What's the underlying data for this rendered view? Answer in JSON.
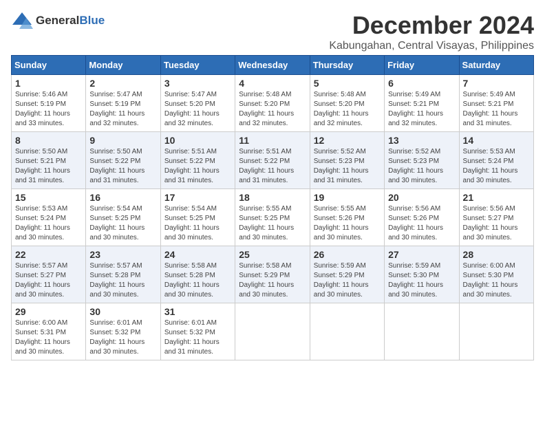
{
  "logo": {
    "general": "General",
    "blue": "Blue"
  },
  "title": {
    "month": "December 2024",
    "location": "Kabungahan, Central Visayas, Philippines"
  },
  "headers": [
    "Sunday",
    "Monday",
    "Tuesday",
    "Wednesday",
    "Thursday",
    "Friday",
    "Saturday"
  ],
  "weeks": [
    [
      {
        "day": "1",
        "info": "Sunrise: 5:46 AM\nSunset: 5:19 PM\nDaylight: 11 hours\nand 33 minutes."
      },
      {
        "day": "2",
        "info": "Sunrise: 5:47 AM\nSunset: 5:19 PM\nDaylight: 11 hours\nand 32 minutes."
      },
      {
        "day": "3",
        "info": "Sunrise: 5:47 AM\nSunset: 5:20 PM\nDaylight: 11 hours\nand 32 minutes."
      },
      {
        "day": "4",
        "info": "Sunrise: 5:48 AM\nSunset: 5:20 PM\nDaylight: 11 hours\nand 32 minutes."
      },
      {
        "day": "5",
        "info": "Sunrise: 5:48 AM\nSunset: 5:20 PM\nDaylight: 11 hours\nand 32 minutes."
      },
      {
        "day": "6",
        "info": "Sunrise: 5:49 AM\nSunset: 5:21 PM\nDaylight: 11 hours\nand 32 minutes."
      },
      {
        "day": "7",
        "info": "Sunrise: 5:49 AM\nSunset: 5:21 PM\nDaylight: 11 hours\nand 31 minutes."
      }
    ],
    [
      {
        "day": "8",
        "info": "Sunrise: 5:50 AM\nSunset: 5:21 PM\nDaylight: 11 hours\nand 31 minutes."
      },
      {
        "day": "9",
        "info": "Sunrise: 5:50 AM\nSunset: 5:22 PM\nDaylight: 11 hours\nand 31 minutes."
      },
      {
        "day": "10",
        "info": "Sunrise: 5:51 AM\nSunset: 5:22 PM\nDaylight: 11 hours\nand 31 minutes."
      },
      {
        "day": "11",
        "info": "Sunrise: 5:51 AM\nSunset: 5:22 PM\nDaylight: 11 hours\nand 31 minutes."
      },
      {
        "day": "12",
        "info": "Sunrise: 5:52 AM\nSunset: 5:23 PM\nDaylight: 11 hours\nand 31 minutes."
      },
      {
        "day": "13",
        "info": "Sunrise: 5:52 AM\nSunset: 5:23 PM\nDaylight: 11 hours\nand 30 minutes."
      },
      {
        "day": "14",
        "info": "Sunrise: 5:53 AM\nSunset: 5:24 PM\nDaylight: 11 hours\nand 30 minutes."
      }
    ],
    [
      {
        "day": "15",
        "info": "Sunrise: 5:53 AM\nSunset: 5:24 PM\nDaylight: 11 hours\nand 30 minutes."
      },
      {
        "day": "16",
        "info": "Sunrise: 5:54 AM\nSunset: 5:25 PM\nDaylight: 11 hours\nand 30 minutes."
      },
      {
        "day": "17",
        "info": "Sunrise: 5:54 AM\nSunset: 5:25 PM\nDaylight: 11 hours\nand 30 minutes."
      },
      {
        "day": "18",
        "info": "Sunrise: 5:55 AM\nSunset: 5:25 PM\nDaylight: 11 hours\nand 30 minutes."
      },
      {
        "day": "19",
        "info": "Sunrise: 5:55 AM\nSunset: 5:26 PM\nDaylight: 11 hours\nand 30 minutes."
      },
      {
        "day": "20",
        "info": "Sunrise: 5:56 AM\nSunset: 5:26 PM\nDaylight: 11 hours\nand 30 minutes."
      },
      {
        "day": "21",
        "info": "Sunrise: 5:56 AM\nSunset: 5:27 PM\nDaylight: 11 hours\nand 30 minutes."
      }
    ],
    [
      {
        "day": "22",
        "info": "Sunrise: 5:57 AM\nSunset: 5:27 PM\nDaylight: 11 hours\nand 30 minutes."
      },
      {
        "day": "23",
        "info": "Sunrise: 5:57 AM\nSunset: 5:28 PM\nDaylight: 11 hours\nand 30 minutes."
      },
      {
        "day": "24",
        "info": "Sunrise: 5:58 AM\nSunset: 5:28 PM\nDaylight: 11 hours\nand 30 minutes."
      },
      {
        "day": "25",
        "info": "Sunrise: 5:58 AM\nSunset: 5:29 PM\nDaylight: 11 hours\nand 30 minutes."
      },
      {
        "day": "26",
        "info": "Sunrise: 5:59 AM\nSunset: 5:29 PM\nDaylight: 11 hours\nand 30 minutes."
      },
      {
        "day": "27",
        "info": "Sunrise: 5:59 AM\nSunset: 5:30 PM\nDaylight: 11 hours\nand 30 minutes."
      },
      {
        "day": "28",
        "info": "Sunrise: 6:00 AM\nSunset: 5:30 PM\nDaylight: 11 hours\nand 30 minutes."
      }
    ],
    [
      {
        "day": "29",
        "info": "Sunrise: 6:00 AM\nSunset: 5:31 PM\nDaylight: 11 hours\nand 30 minutes."
      },
      {
        "day": "30",
        "info": "Sunrise: 6:01 AM\nSunset: 5:32 PM\nDaylight: 11 hours\nand 30 minutes."
      },
      {
        "day": "31",
        "info": "Sunrise: 6:01 AM\nSunset: 5:32 PM\nDaylight: 11 hours\nand 31 minutes."
      },
      {
        "day": "",
        "info": ""
      },
      {
        "day": "",
        "info": ""
      },
      {
        "day": "",
        "info": ""
      },
      {
        "day": "",
        "info": ""
      }
    ]
  ]
}
